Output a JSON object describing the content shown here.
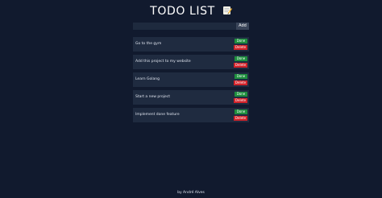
{
  "header": {
    "title": "TODO LIST",
    "title_icon": "memo-icon"
  },
  "form": {
    "input_value": "",
    "input_placeholder": "",
    "add_label": "Add"
  },
  "todos": [
    {
      "text": "Go to the gym",
      "done_label": "Done",
      "delete_label": "Delete"
    },
    {
      "text": "Add this project to my website",
      "done_label": "Done",
      "delete_label": "Delete"
    },
    {
      "text": "Learn Golang",
      "done_label": "Done",
      "delete_label": "Delete"
    },
    {
      "text": "Start a new project",
      "done_label": "Done",
      "delete_label": "Delete"
    },
    {
      "text": "Implement done feature",
      "done_label": "Done",
      "delete_label": "Delete"
    }
  ],
  "footer": {
    "credit": "by André Alves"
  },
  "colors": {
    "background": "#111a2e",
    "item_background": "#1f2b40",
    "done": "#1e8f3e",
    "delete": "#d2232a",
    "add_button": "#3a4559"
  }
}
